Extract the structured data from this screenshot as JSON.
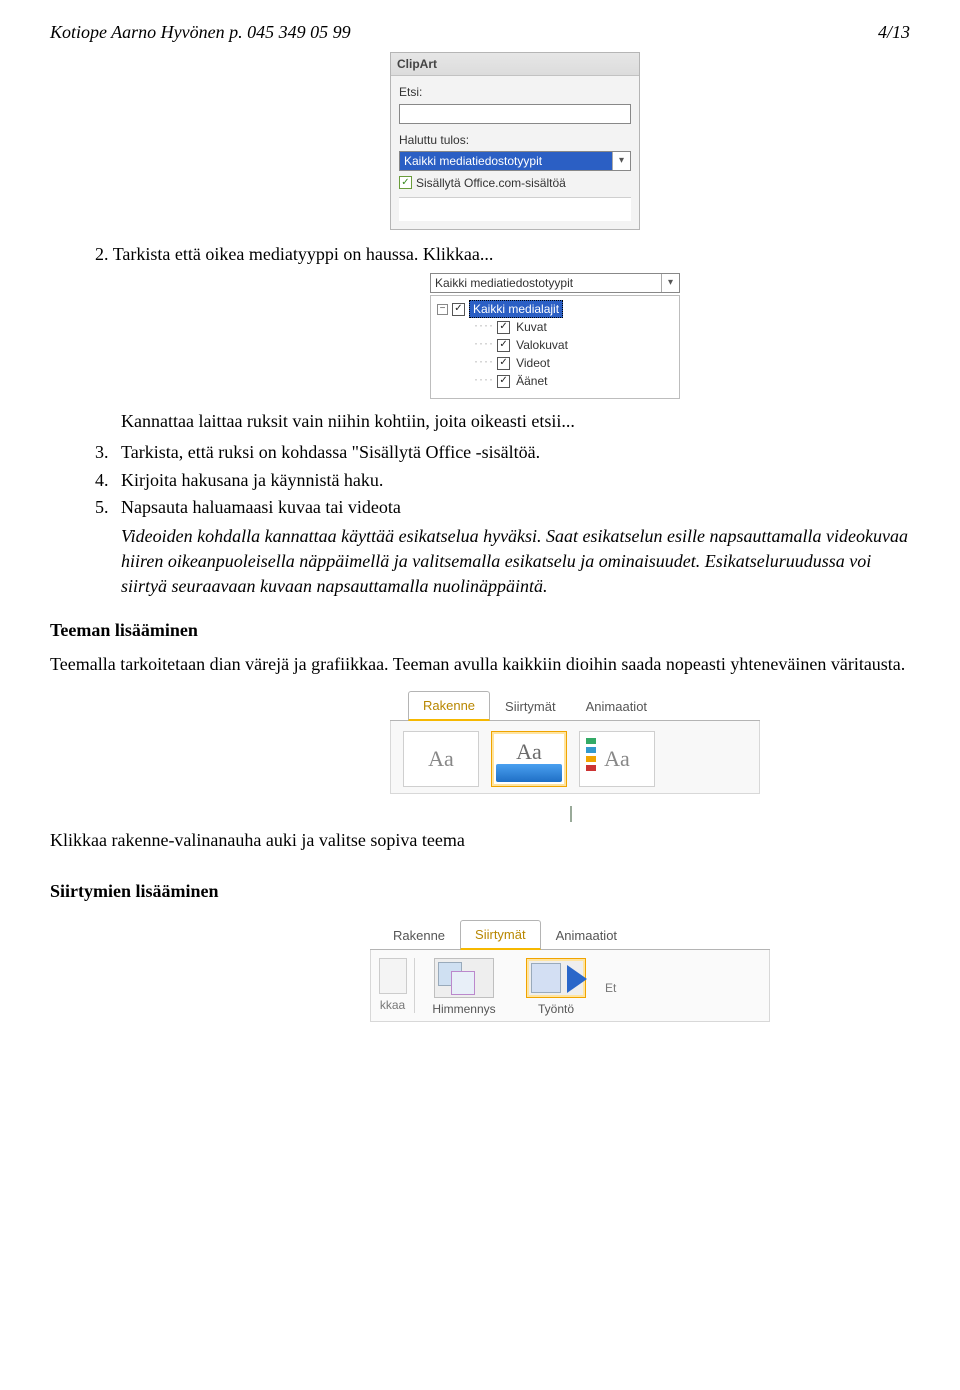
{
  "header": {
    "left": "Kotiope Aarno Hyvönen  p. 045 349 05 99",
    "right": "4/13"
  },
  "clipart": {
    "title": "ClipArt",
    "etsi_label": "Etsi:",
    "haluttu_label": "Haluttu tulos:",
    "selected": "Kaikki mediatiedostotyypit",
    "include_office": "Sisällytä Office.com-sisältöä"
  },
  "step2": {
    "num": "2.",
    "text": "Tarkista että oikea mediatyyppi on haussa. Klikkaa..."
  },
  "dropdown": {
    "header": "Kaikki mediatiedostotyypit",
    "root": "Kaikki medialajit",
    "items": [
      "Kuvat",
      "Valokuvat",
      "Videot",
      "Äänet"
    ]
  },
  "step3_intro": "Kannattaa laittaa ruksit vain niihin kohtiin, joita oikeasti etsii...",
  "steps": {
    "s3": {
      "num": "3.",
      "text": "Tarkista, että ruksi on kohdassa \"Sisällytä Office -sisältöä."
    },
    "s4": {
      "num": "4.",
      "text": "Kirjoita hakusana ja käynnistä haku."
    },
    "s5": {
      "num": "5.",
      "text": "Napsauta haluamaasi kuvaa tai videota"
    }
  },
  "italic_note": "Videoiden kohdalla kannattaa käyttää esikatselua hyväksi. Saat esikatselun esille napsauttamalla videokuvaa hiiren oikeanpuoleisella näppäimellä ja valitsemalla esikatselu ja ominaisuudet. Esikatseluruudussa voi siirtyä seuraavaan kuvaan napsauttamalla nuolinäppäintä.",
  "h2": "Teeman lisääminen",
  "para1": "Teemalla tarkoitetaan dian värejä ja grafiikkaa. Teeman avulla kaikkiin dioihin saada nopeasti yhteneväinen väritausta.",
  "ribbon": {
    "tabs": [
      "Rakenne",
      "Siirtymät",
      "Animaatiot"
    ],
    "aa": "Aa"
  },
  "para2": "Klikkaa rakenne-valinanauha auki ja valitse sopiva teema",
  "h3": "Siirtymien lisääminen",
  "ribbon2": {
    "tabs": [
      "Rakenne",
      "Siirtymät",
      "Animaatiot"
    ],
    "left_label": "kkaa",
    "tile1": "Himmennys",
    "tile2": "Työntö",
    "et": "Et"
  }
}
